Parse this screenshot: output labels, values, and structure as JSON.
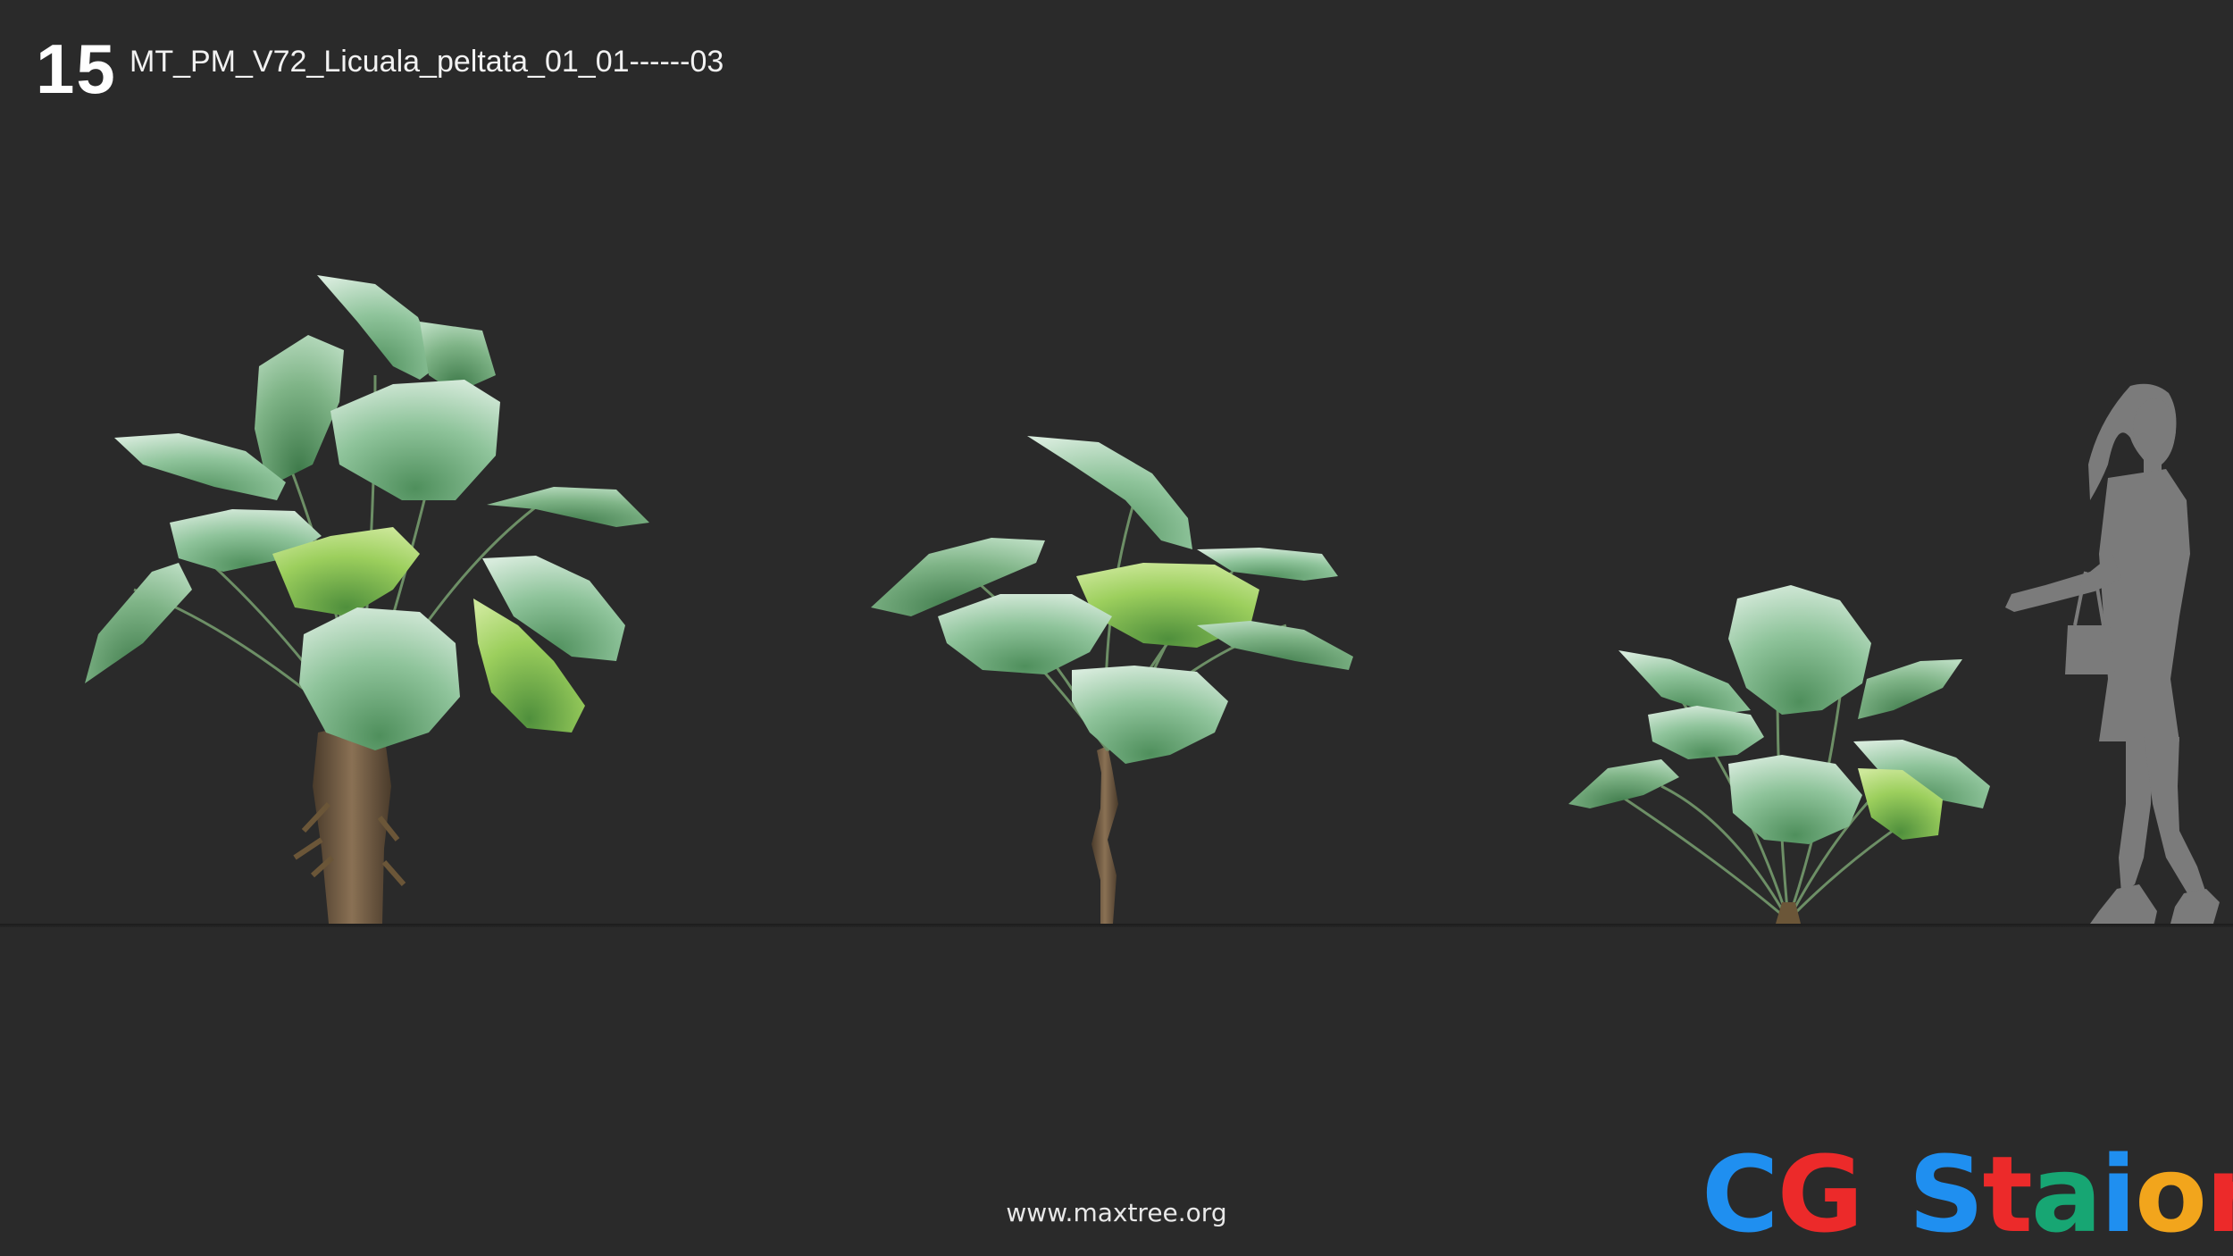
{
  "header": {
    "index_number": "15",
    "model_name": "MT_PM_V72_Licuala_peltata_01_01------03"
  },
  "footer": {
    "website": "www.maxtree.org"
  },
  "logo": {
    "letters": [
      {
        "char": "C",
        "color": "#1f8ff0"
      },
      {
        "char": "G",
        "color": "#ec2a2a"
      },
      {
        "char": "S",
        "color": "#1f8ff0"
      },
      {
        "char": "t",
        "color": "#ec2a2a"
      },
      {
        "char": "a",
        "color": "#17a673"
      },
      {
        "char": "i",
        "color": "#1f8ff0"
      },
      {
        "char": "o",
        "color": "#f2a51c"
      },
      {
        "char": "n",
        "color": "#ec2a2a"
      }
    ]
  },
  "colors": {
    "background": "#2a2a2a",
    "leaf_light": "#d7ebdc",
    "leaf_mid": "#8fc49b",
    "leaf_dark": "#4f8f5c",
    "leaf_yellow": "#b6d86a",
    "trunk": "#7a6248",
    "silhouette": "#7b7b7b"
  },
  "scene": {
    "plants": [
      "palm-tall",
      "palm-curved-trunk",
      "palm-bush"
    ],
    "scale_reference": "human-silhouette"
  }
}
